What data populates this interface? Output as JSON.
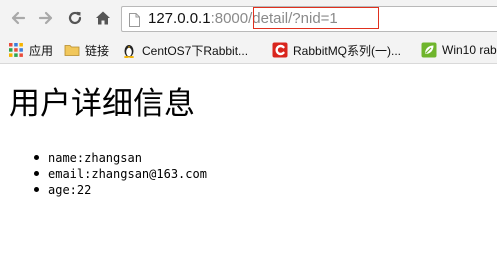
{
  "toolbar": {
    "url_host": "127.0.0.1",
    "url_port": ":8000",
    "url_path": "/detail/?nid=1"
  },
  "bookmarks": [
    {
      "label": "应用",
      "icon": "apps-grid-icon"
    },
    {
      "label": "链接",
      "icon": "folder-icon"
    },
    {
      "label": "CentOS7下Rabbit...",
      "icon": "linux-tux-icon"
    },
    {
      "label": "RabbitMQ系列(一)...",
      "icon": "red-c-logo-icon"
    },
    {
      "label": "Win10 rab",
      "icon": "green-leaf-logo-icon"
    }
  ],
  "page": {
    "title": "用户详细信息",
    "items": [
      "name:zhangsan",
      "email:zhangsan@163.com",
      "age:22"
    ]
  },
  "colors": {
    "highlight_box": "#e0301e",
    "toolbar_bg": "#f3f3f3"
  }
}
